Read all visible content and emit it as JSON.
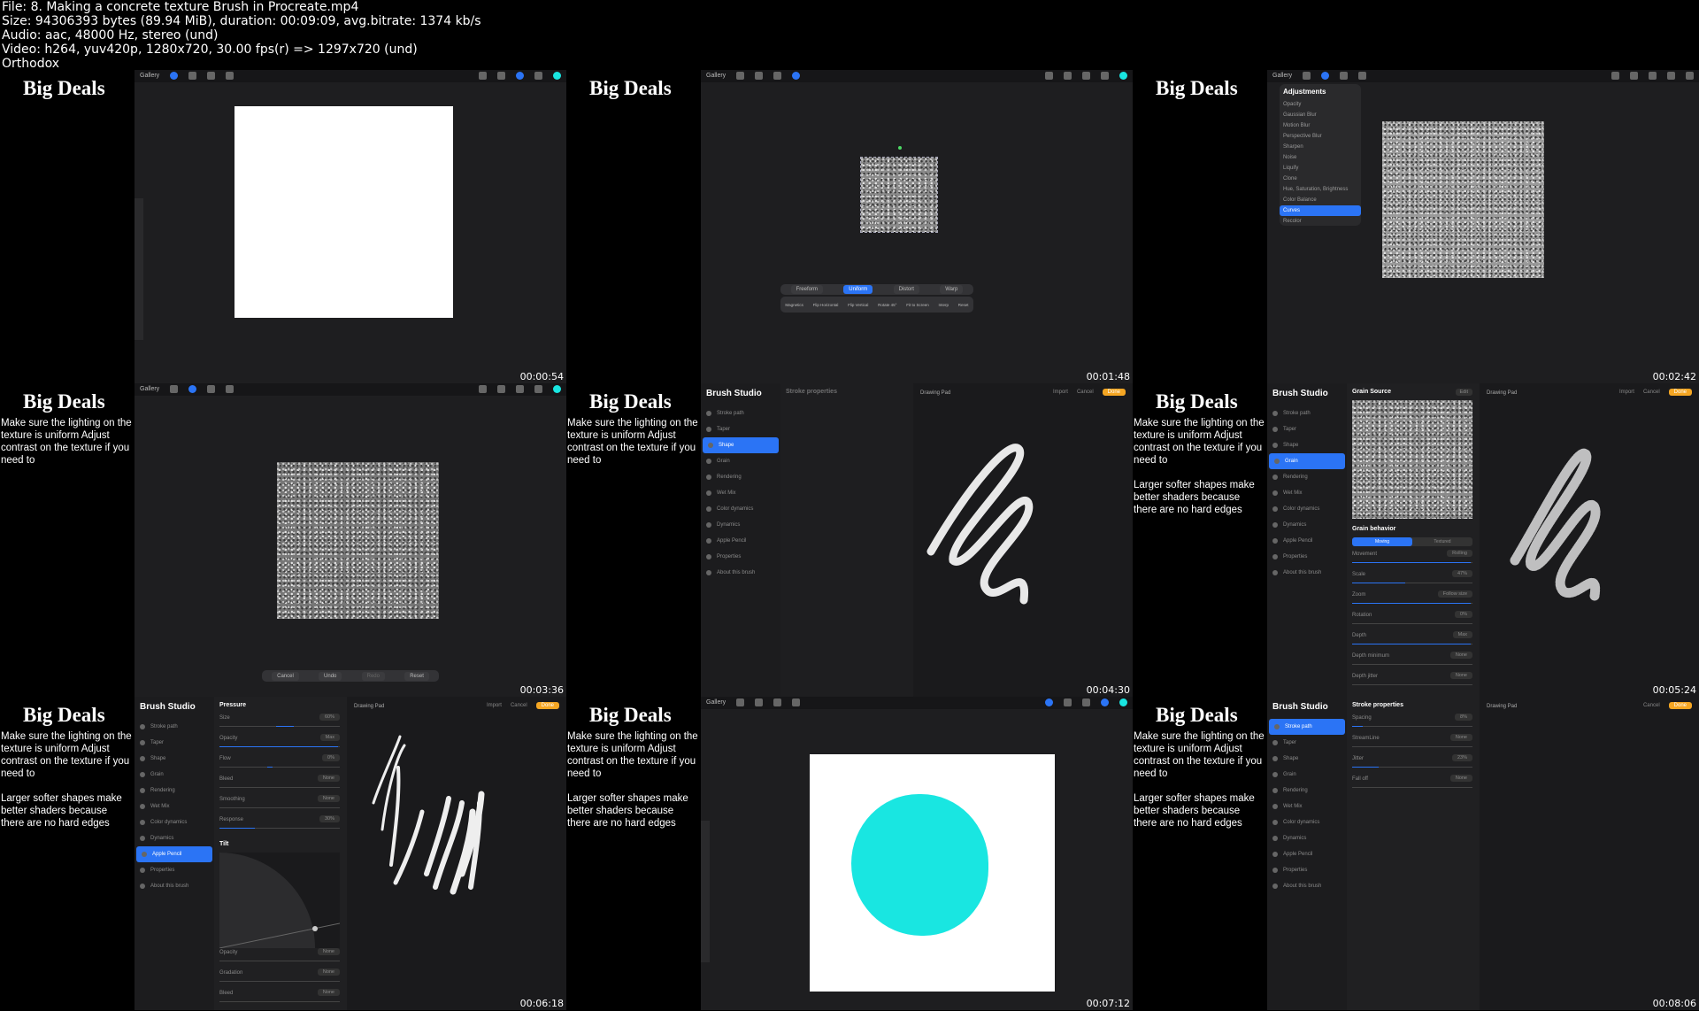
{
  "header": {
    "line1": "File: 8. Making a concrete texture Brush in Procreate.mp4",
    "line2": "Size: 94306393 bytes (89.94 MiB), duration: 00:09:09, avg.bitrate: 1374 kb/s",
    "line3": "Audio: aac, 48000 Hz, stereo (und)",
    "line4": "Video: h264, yuv420p, 1280x720, 30.00 fps(r) => 1297x720 (und)",
    "line5": "Orthodox"
  },
  "brand": "Big Deals",
  "notes": {
    "lighting": "Make sure the lighting on the texture is uniform Adjust contrast on the texture if you need to",
    "softer": "Larger softer shapes make better shaders because there are no hard edges"
  },
  "gallery": "Gallery",
  "timestamps": [
    "00:00:54",
    "00:01:48",
    "00:02:42",
    "00:03:36",
    "00:04:30",
    "00:05:24",
    "00:06:18",
    "00:07:12",
    "00:08:06"
  ],
  "transform_bar": [
    "Freeform",
    "Uniform",
    "Distort",
    "Warp"
  ],
  "transform_tools": [
    "Magnetics",
    "Flip Horizontal",
    "Flip Vertical",
    "Rotate 45°",
    "Fit to Screen",
    "Interp",
    "Reset"
  ],
  "adjustments": {
    "title": "Adjustments",
    "items": [
      "Opacity",
      "Gaussian Blur",
      "Motion Blur",
      "Perspective Blur",
      "Sharpen",
      "Noise",
      "Liquify",
      "Clone",
      "Hue, Saturation, Brightness",
      "Color Balance",
      "Curves",
      "Recolor"
    ],
    "selected": "Curves"
  },
  "curve_buttons": [
    "Cancel",
    "Undo",
    "Redo",
    "Reset"
  ],
  "studio": {
    "title": "Brush Studio",
    "items": [
      "Stroke path",
      "Taper",
      "Shape",
      "Grain",
      "Rendering",
      "Wet Mix",
      "Color dynamics",
      "Dynamics",
      "Apple Pencil",
      "Properties",
      "About this brush"
    ],
    "pad": "Drawing Pad",
    "import": "Import",
    "cancel": "Cancel",
    "done": "Done"
  },
  "panels": {
    "shape": {
      "title": "Stroke properties"
    },
    "grain": {
      "title": "Grain Source",
      "edit": "Edit",
      "behavior": "Grain behavior",
      "moving": "Moving",
      "textured": "Textured",
      "rows": [
        {
          "label": "Movement",
          "value": "Rolling"
        },
        {
          "label": "Scale",
          "value": "47%"
        },
        {
          "label": "Zoom",
          "value": "Follow size"
        },
        {
          "label": "Rotation",
          "value": "0%"
        },
        {
          "label": "Depth",
          "value": "Max"
        },
        {
          "label": "Depth minimum",
          "value": "None"
        },
        {
          "label": "Depth jitter",
          "value": "None"
        }
      ]
    },
    "pencil": {
      "title": "Pressure",
      "rows": [
        {
          "label": "Size",
          "value": "60%"
        },
        {
          "label": "Opacity",
          "value": "Max"
        },
        {
          "label": "Flow",
          "value": "0%"
        },
        {
          "label": "Bleed",
          "value": "None"
        },
        {
          "label": "Smoothing",
          "value": "None"
        },
        {
          "label": "Response",
          "value": "30%"
        }
      ],
      "tilt": "Tilt",
      "tilt_rows": [
        {
          "label": "Opacity",
          "value": "None"
        },
        {
          "label": "Gradation",
          "value": "None"
        },
        {
          "label": "Bleed",
          "value": "None"
        }
      ]
    },
    "stroke": {
      "title": "Stroke properties",
      "rows": [
        {
          "label": "Spacing",
          "value": "8%"
        },
        {
          "label": "StreamLine",
          "value": "None"
        },
        {
          "label": "Jitter",
          "value": "23%"
        },
        {
          "label": "Fall off",
          "value": "None"
        }
      ]
    }
  },
  "colors": {
    "accent": "#2b74f5",
    "cyan": "#19e6e1",
    "done": "#f5a623"
  }
}
